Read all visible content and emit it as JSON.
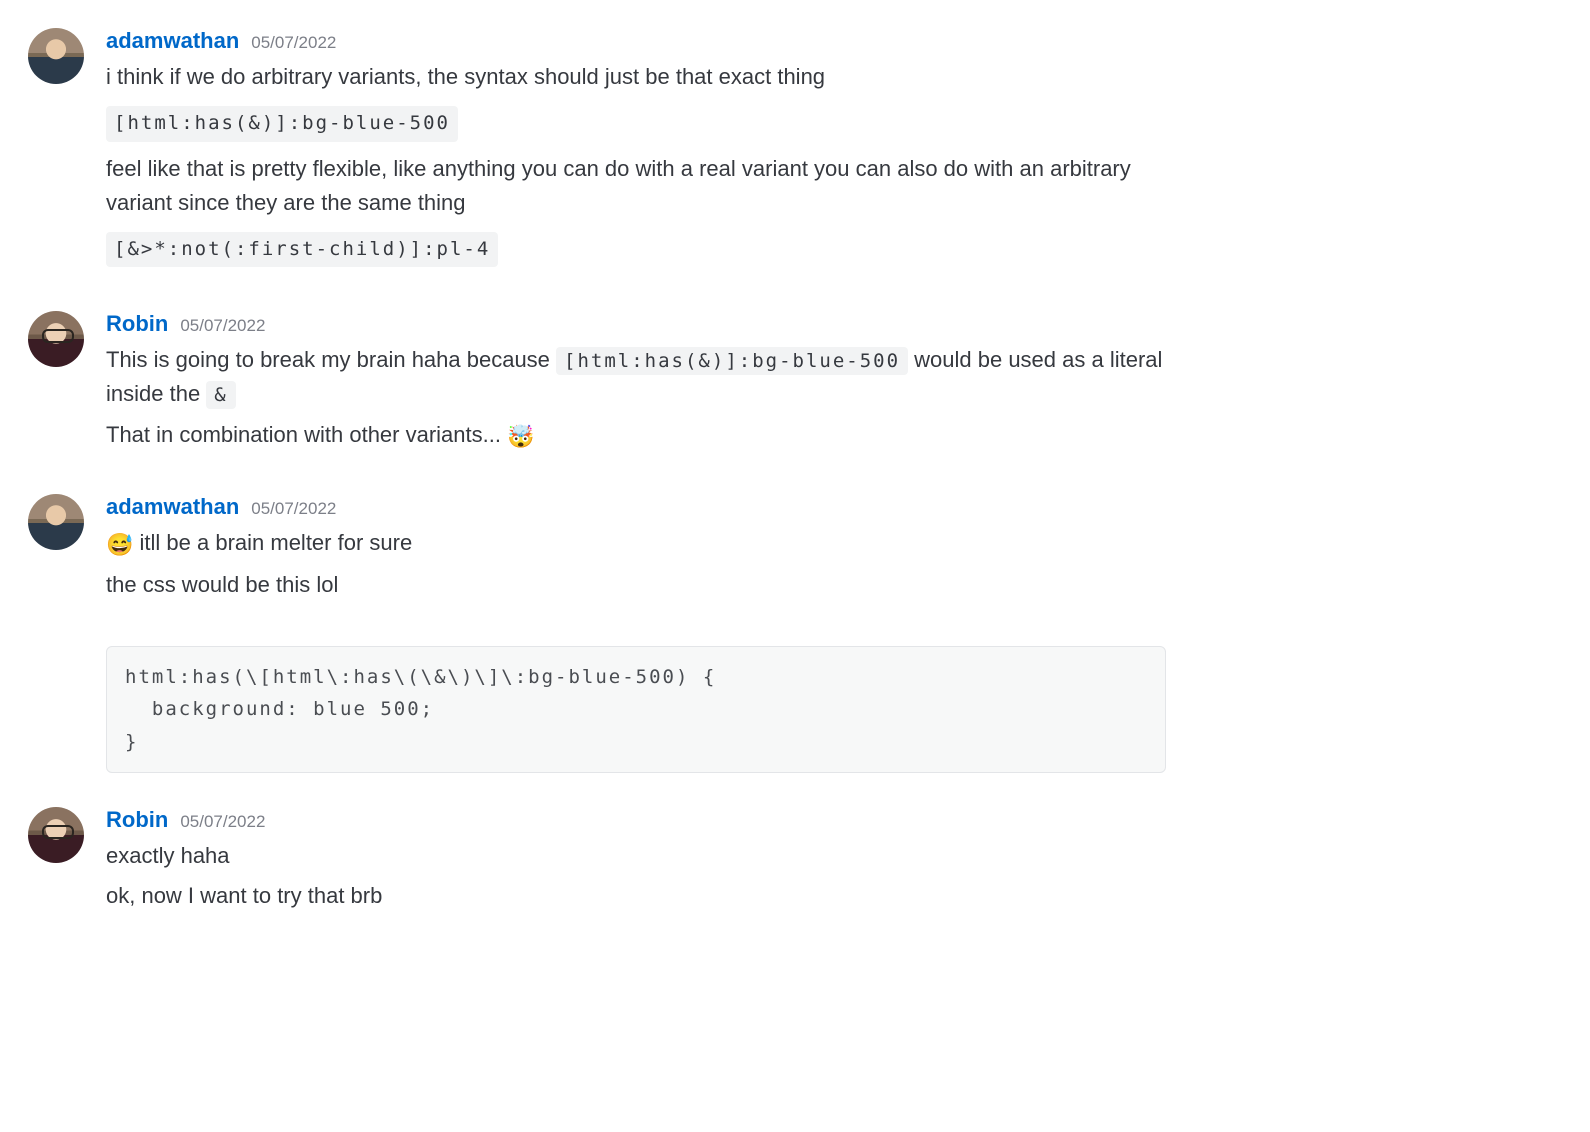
{
  "messages": [
    {
      "author": "adamwathan",
      "avatar": "adam",
      "timestamp": "05/07/2022",
      "lines": [
        {
          "type": "text",
          "value": "i think if we do arbitrary variants, the syntax should just be that exact thing"
        },
        {
          "type": "code-chip",
          "value": "[html:has(&)]:bg-blue-500"
        },
        {
          "type": "text",
          "value": "feel like that is pretty flexible, like anything you can do with  a real variant you can also do with an arbitrary variant since they are the same thing"
        },
        {
          "type": "code-chip",
          "value": "[&>*:not(:first-child)]:pl-4"
        }
      ]
    },
    {
      "author": "Robin",
      "avatar": "robin",
      "timestamp": "05/07/2022",
      "lines": [
        {
          "type": "mixed",
          "parts": [
            {
              "t": "text",
              "v": "This is going to break my brain haha because "
            },
            {
              "t": "code",
              "v": "[html:has(&)]:bg-blue-500"
            },
            {
              "t": "text",
              "v": " would be used as a literal inside the "
            },
            {
              "t": "code",
              "v": "&"
            }
          ]
        },
        {
          "type": "mixed",
          "parts": [
            {
              "t": "text",
              "v": "That in combination with other variants... "
            },
            {
              "t": "emoji",
              "v": "🤯"
            }
          ]
        }
      ]
    },
    {
      "author": "adamwathan",
      "avatar": "adam",
      "timestamp": "05/07/2022",
      "lines": [
        {
          "type": "mixed",
          "parts": [
            {
              "t": "emoji",
              "v": "😅"
            },
            {
              "t": "text",
              "v": " itll be a brain melter for sure"
            }
          ]
        },
        {
          "type": "text",
          "value": "the css would be this lol"
        },
        {
          "type": "code-block",
          "value": "html:has(\\[html\\:has\\(\\&\\)\\]\\:bg-blue-500) {\n  background: blue 500;\n}"
        }
      ]
    },
    {
      "author": "Robin",
      "avatar": "robin",
      "timestamp": "05/07/2022",
      "lines": [
        {
          "type": "text",
          "value": "exactly haha"
        },
        {
          "type": "text",
          "value": "ok, now I want to try that brb"
        }
      ]
    }
  ]
}
